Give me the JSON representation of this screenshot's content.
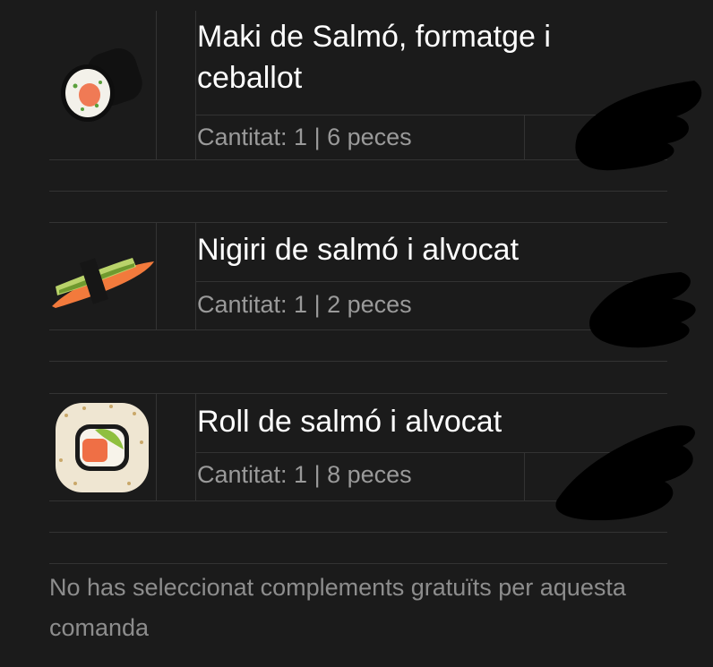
{
  "order_items": [
    {
      "name": "Maki de Salmó, formatge i ceballot",
      "quantity_text": "Cantitat: 1 | 6 peces",
      "image_icon": "maki-roll-image"
    },
    {
      "name": "Nigiri de salmó i alvocat",
      "quantity_text": "Cantitat: 1 | 2 peces",
      "image_icon": "nigiri-image"
    },
    {
      "name": "Roll de salmó i alvocat",
      "quantity_text": "Cantitat: 1 | 8 peces",
      "image_icon": "uramaki-roll-image"
    }
  ],
  "footer_note": "No has seleccionat complements gratuïts per aquesta comanda",
  "colors": {
    "background": "#1b1b1b",
    "divider": "#333333",
    "title_text": "#ffffff",
    "secondary_text": "#9a9a9a",
    "redaction": "#000000"
  }
}
